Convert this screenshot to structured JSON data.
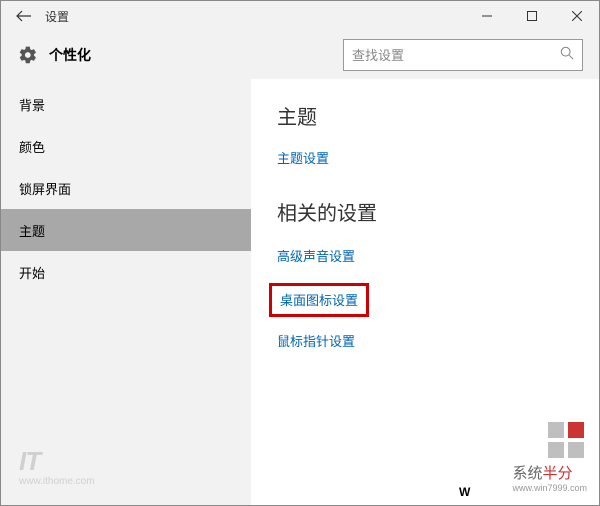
{
  "window": {
    "title": "设置"
  },
  "header": {
    "heading": "个性化",
    "search_placeholder": "查找设置"
  },
  "sidebar": {
    "items": [
      {
        "label": "背景",
        "selected": false
      },
      {
        "label": "颜色",
        "selected": false
      },
      {
        "label": "锁屏界面",
        "selected": false
      },
      {
        "label": "主题",
        "selected": true
      },
      {
        "label": "开始",
        "selected": false
      }
    ]
  },
  "main": {
    "section1_heading": "主题",
    "section1_link": "主题设置",
    "section2_heading": "相关的设置",
    "related_links": [
      {
        "label": "高级声音设置",
        "highlighted": false
      },
      {
        "label": "桌面图标设置",
        "highlighted": true
      },
      {
        "label": "鼠标指针设置",
        "highlighted": false
      }
    ]
  },
  "watermarks": {
    "left_brand": "IT",
    "left_url": "www.ithome.com",
    "right_text_a": "系统",
    "right_text_b": "半分",
    "right_url": "www.win7999.com",
    "w": "W"
  }
}
